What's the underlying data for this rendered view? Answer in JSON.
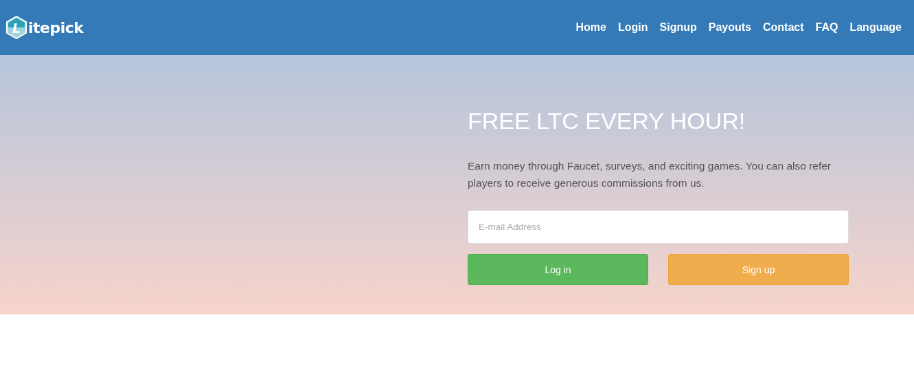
{
  "header": {
    "logo": {
      "mark": "L",
      "text": "itepick"
    },
    "nav": [
      {
        "label": "Home"
      },
      {
        "label": "Login"
      },
      {
        "label": "Signup"
      },
      {
        "label": "Payouts"
      },
      {
        "label": "Contact"
      },
      {
        "label": "FAQ"
      },
      {
        "label": "Language"
      }
    ]
  },
  "hero": {
    "title": "FREE LTC EVERY HOUR!",
    "text": "Earn money through Faucet, surveys, and exciting games. You can also refer players to receive generous commissions from us.",
    "email": {
      "placeholder": "E-mail Address"
    },
    "buttons": [
      {
        "label": "Log in",
        "kind": "success"
      },
      {
        "label": "Sign up",
        "kind": "warning"
      }
    ]
  }
}
